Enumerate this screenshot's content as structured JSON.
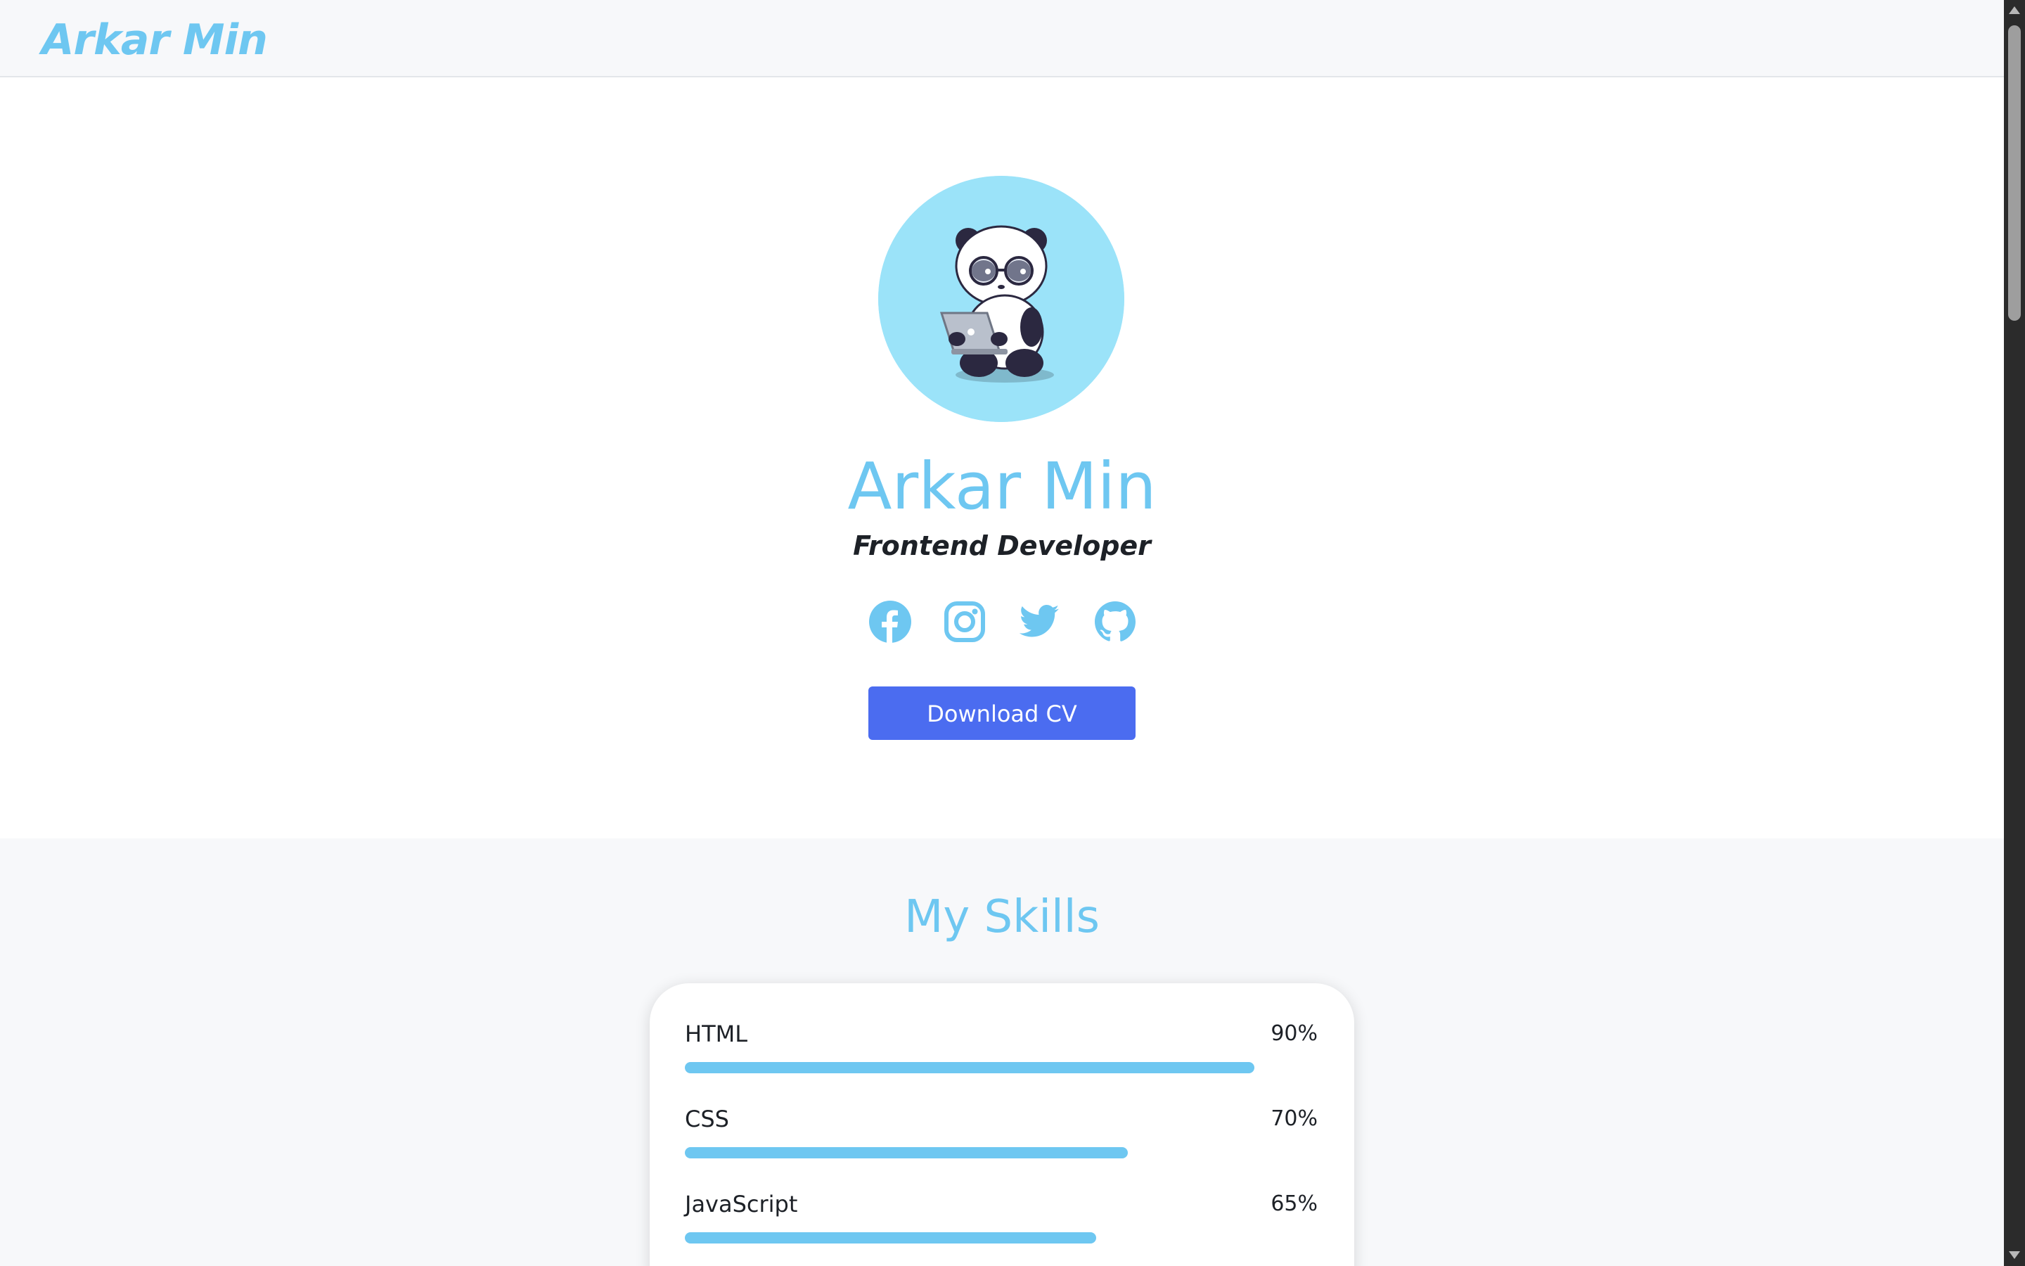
{
  "header": {
    "brand": "Arkar Min"
  },
  "hero": {
    "avatar_icon": "panda-with-laptop-avatar",
    "name": "Arkar Min",
    "role": "Frontend Developer",
    "socials": [
      {
        "icon": "facebook-icon"
      },
      {
        "icon": "instagram-icon"
      },
      {
        "icon": "twitter-icon"
      },
      {
        "icon": "github-icon"
      }
    ],
    "download_label": "Download CV"
  },
  "skills": {
    "title": "My Skills",
    "items": [
      {
        "name": "HTML",
        "percent_label": "90%",
        "percent": 90
      },
      {
        "name": "CSS",
        "percent_label": "70%",
        "percent": 70
      },
      {
        "name": "JavaScript",
        "percent_label": "65%",
        "percent": 65
      }
    ]
  },
  "colors": {
    "accent": "#6ec7f1",
    "button": "#4b6cf0",
    "header_bg": "#f7f8fa",
    "avatar_bg": "#9be3f9"
  }
}
